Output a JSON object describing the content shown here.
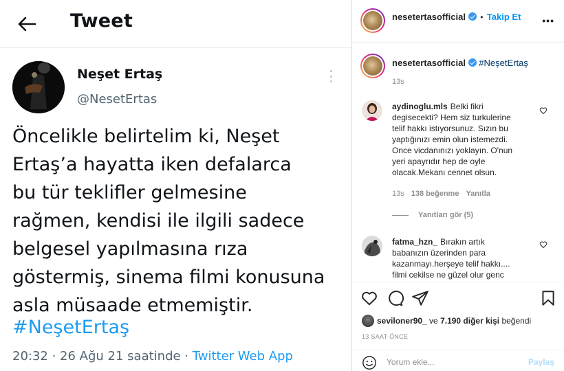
{
  "tweet": {
    "header_title": "Tweet",
    "author_name": "Neşet Ertaş",
    "author_handle": "@NesetErtas",
    "body_lines": [
      "Öncelikle belirtelim ki, Neşet",
      "Ertaş’a hayatta iken defalarca",
      "bu tür teklifler gelmesine",
      "rağmen, kendisi ile ilgili sadece",
      "belgesel yapılmasına rıza",
      "göstermiş, sinema filmi konusuna",
      "asla müsaade etmemiştir."
    ],
    "hashtag": "#NeşetErtaş",
    "timestamp": "20:32 · 26 Ağu 21 saatinde · ",
    "source": "Twitter Web App",
    "colors": {
      "link": "#1d9bf0",
      "text": "#0f1419",
      "muted": "#536471"
    }
  },
  "instagram": {
    "header": {
      "username": "nesetertasofficial",
      "separator": "•",
      "follow_label": "Takip Et",
      "more_label": "•••"
    },
    "caption": {
      "username": "nesetertasofficial",
      "hashtag": "#NeşetErtaş",
      "time": "13s"
    },
    "comments": [
      {
        "username": "aydinoglu.mls",
        "lines": [
          "Belki fikri",
          "degisecekti? Hem siz turkulerine",
          "telif hakkı istıyorsunuz. Sızın bu",
          "yaptığınızı emin olun istemezdi.",
          "Once vicdanınızı yoklayın. O'nun",
          "yeri apayrıdır hep de oyle",
          "olacak.Mekanı cennet olsun."
        ],
        "time": "13s",
        "likes": "138 beğenme",
        "reply_label": "Yanıtla",
        "replies_label": "Yanıtları gör (5)"
      },
      {
        "username": "fatma_hzn_",
        "lines": [
          "Bırakın artık",
          "babanızın üzerinden para",
          "kazanmayı.herşeye telif hakkı....",
          "filmi cekilse ne güzel olur genc"
        ]
      }
    ],
    "likes": {
      "first_user": "seviloner90_",
      "connector": " ve ",
      "others": "7.190 diğer kişi",
      "suffix": " beğendi"
    },
    "date": "13 SAAT ÖNCE",
    "comment_placeholder": "Yorum ekle...",
    "post_label": "Paylaş",
    "colors": {
      "link": "#0095f6",
      "hashtag": "#00376b",
      "muted": "#8e8e8e",
      "verified": "#3897f0"
    }
  }
}
